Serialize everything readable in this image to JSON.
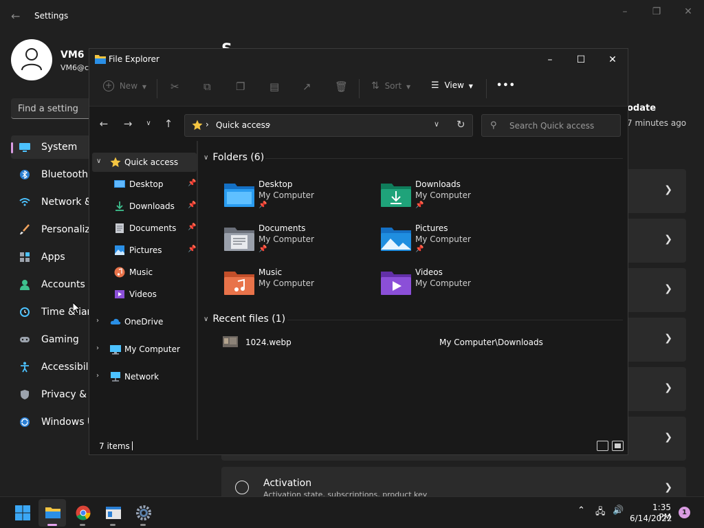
{
  "settings": {
    "title": "Settings",
    "user": {
      "name": "VM6",
      "email": "VM6@c"
    },
    "search_placeholder": "Find a setting",
    "heading": "S",
    "nav": [
      {
        "label": "System",
        "icon": "monitor-icon"
      },
      {
        "label": "Bluetooth &",
        "icon": "bluetooth-icon"
      },
      {
        "label": "Network &",
        "icon": "wifi-icon"
      },
      {
        "label": "Personaliza",
        "icon": "brush-icon"
      },
      {
        "label": "Apps",
        "icon": "apps-icon"
      },
      {
        "label": "Accounts",
        "icon": "person-icon"
      },
      {
        "label": "Time & lang",
        "icon": "clock-icon"
      },
      {
        "label": "Gaming",
        "icon": "gamepad-icon"
      },
      {
        "label": "Accessibilit",
        "icon": "accessibility-icon"
      },
      {
        "label": "Privacy & se",
        "icon": "shield-icon"
      },
      {
        "label": "Windows U",
        "icon": "update-icon"
      }
    ],
    "update": {
      "title": "odate",
      "subtitle": "7 minutes ago"
    },
    "activation": {
      "title": "Activation",
      "subtitle": "Activation state, subscriptions, product key"
    }
  },
  "explorer": {
    "title": "File Explorer",
    "toolbar": {
      "new": "New",
      "sort": "Sort",
      "view": "View",
      "more": "•••"
    },
    "address": {
      "location": "Quick access"
    },
    "search_placeholder": "Search Quick access",
    "tree": [
      {
        "label": "Quick access",
        "icon": "star-icon",
        "selected": true,
        "expanded": true
      },
      {
        "label": "Desktop",
        "icon": "desktop-icon",
        "pinned": true
      },
      {
        "label": "Downloads",
        "icon": "download-icon",
        "pinned": true
      },
      {
        "label": "Documents",
        "icon": "document-icon",
        "pinned": true
      },
      {
        "label": "Pictures",
        "icon": "picture-icon",
        "pinned": true
      },
      {
        "label": "Music",
        "icon": "music-icon"
      },
      {
        "label": "Videos",
        "icon": "video-icon"
      },
      {
        "label": "OneDrive",
        "icon": "cloud-icon"
      },
      {
        "label": "My Computer",
        "icon": "computer-icon"
      },
      {
        "label": "Network",
        "icon": "network-icon"
      }
    ],
    "folders_header": "Folders (6)",
    "folders": [
      {
        "name": "Desktop",
        "location": "My Computer",
        "pinned": true,
        "color": "#1e8fe6"
      },
      {
        "name": "Downloads",
        "location": "My Computer",
        "pinned": true,
        "color": "#1fa37a"
      },
      {
        "name": "Documents",
        "location": "My Computer",
        "pinned": true,
        "color": "#9aa0ab"
      },
      {
        "name": "Pictures",
        "location": "My Computer",
        "pinned": true,
        "color": "#1f8ee0"
      },
      {
        "name": "Music",
        "location": "My Computer",
        "pinned": false,
        "color": "#e8734a"
      },
      {
        "name": "Videos",
        "location": "My Computer",
        "pinned": false,
        "color": "#8b4fd8"
      }
    ],
    "recent_header": "Recent files (1)",
    "recent": [
      {
        "name": "1024.webp",
        "path": "My Computer\\Downloads"
      }
    ],
    "status": {
      "count": "7 items"
    }
  },
  "taskbar": {
    "time": "1:35 PM",
    "date": "6/14/2022",
    "notifications": "1"
  },
  "colors": {
    "accent": "#d99ce2",
    "folder_yellow": "#f4c542"
  }
}
